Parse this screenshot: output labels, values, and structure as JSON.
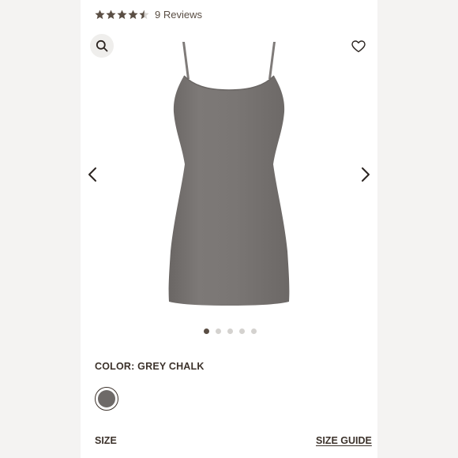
{
  "rating": {
    "value": 4.5,
    "max": 5,
    "reviews_label": "9 Reviews",
    "star_color": "#5a4e44"
  },
  "icons": {
    "search": "search-icon",
    "wishlist": "heart-icon",
    "prev": "chevron-left-icon",
    "next": "chevron-right-icon"
  },
  "gallery": {
    "image_count": 5,
    "active_index": 0
  },
  "product": {
    "color_label": "COLOR: GREY CHALK",
    "swatch_color": "#6e6a68",
    "size_label": "SIZE",
    "size_guide_label": "SIZE GUIDE"
  }
}
